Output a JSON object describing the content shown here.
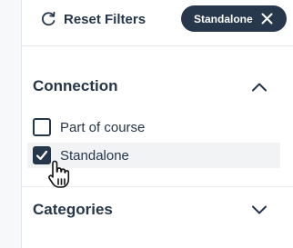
{
  "toolbar": {
    "reset_label": "Reset Filters",
    "reset_icon": "refresh-icon"
  },
  "active_filter_chip": {
    "label": "Standalone",
    "close_icon": "close-icon"
  },
  "sections": {
    "connection": {
      "title": "Connection",
      "expanded": true,
      "chevron_icon": "chevron-up-icon",
      "options": [
        {
          "label": "Part of course",
          "checked": false
        },
        {
          "label": "Standalone",
          "checked": true
        }
      ]
    },
    "categories": {
      "title": "Categories",
      "expanded": false,
      "chevron_icon": "chevron-down-icon"
    }
  },
  "colors": {
    "text": "#26364a",
    "chip_bg": "#27384c",
    "hover_row_bg": "#f1f3f5"
  }
}
